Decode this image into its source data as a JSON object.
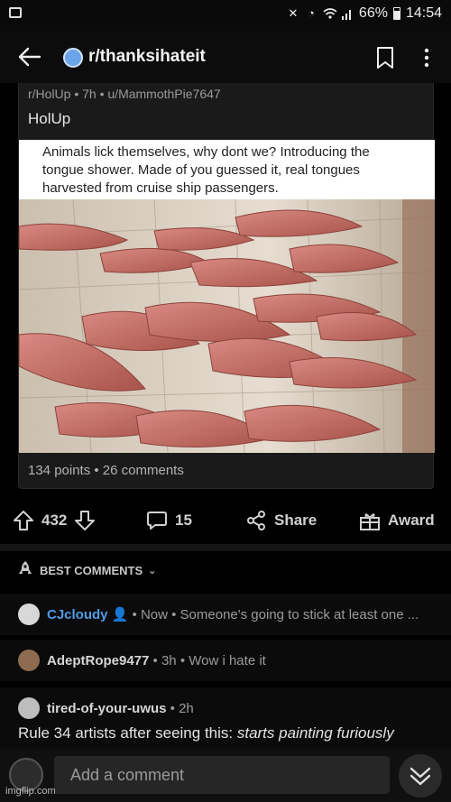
{
  "status_bar": {
    "battery": "66%",
    "time": "14:54",
    "icons": [
      "image-icon",
      "mute-icon",
      "alarm-icon",
      "wifi-icon",
      "signal-icon",
      "battery-icon"
    ]
  },
  "header": {
    "subreddit": "r/thanksihateit",
    "icons": [
      "back-arrow-icon",
      "bookmark-icon",
      "more-icon"
    ]
  },
  "post": {
    "meta": "r/HolUp • 7h • u/MammothPie7647",
    "title": "HolUp",
    "caption": "Animals lick themselves, why dont we? Introducing the tongue shower. Made of you guessed it, real tongues harvested from cruise ship passengers.",
    "stats": "134 points • 26 comments"
  },
  "actions": {
    "votes": "432",
    "comments": "15",
    "share": "Share",
    "award": "Award"
  },
  "comments_section": {
    "sort_label": "BEST COMMENTS"
  },
  "comments": [
    {
      "user": "CJcloudy",
      "meta": " • Now • Someone's going to stick at least one ..."
    },
    {
      "user": "AdeptRope9477",
      "meta": " • 3h • Wow i hate it"
    },
    {
      "user": "tired-of-your-uwus",
      "meta": " • 2h",
      "body_plain": "Rule 34 artists after seeing this: ",
      "body_italic": "starts painting furiously"
    }
  ],
  "composer": {
    "placeholder": "Add a comment"
  },
  "watermark": "imgflip.com",
  "colors": {
    "background": "#000000",
    "mod_blue": "#4f9be8",
    "card": "#1a1a1b"
  }
}
